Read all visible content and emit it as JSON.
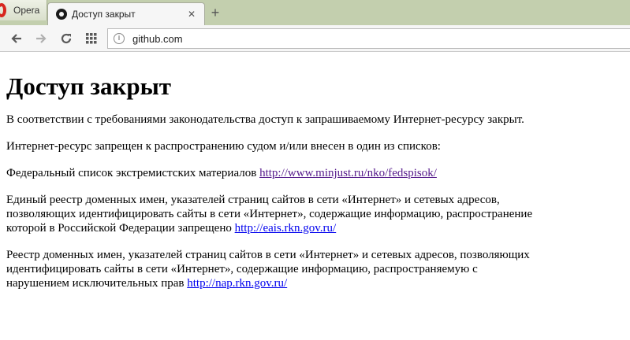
{
  "browser": {
    "menu_label": "Opera",
    "tab": {
      "title": "Доступ закрыт",
      "close_glyph": "✕"
    },
    "new_tab_glyph": "+",
    "address": "github.com",
    "info_glyph": "i"
  },
  "page": {
    "heading": "Доступ закрыт",
    "intro": "В соответствии с требованиями законодательства доступ к запрашиваемому Интернет-ресурсу закрыт.",
    "reason": "Интернет-ресурс запрещен к распространению судом и/или внесен в один из списков:",
    "list1_text": "Федеральный список экстремистских материалов",
    "list1_link": "http://www.minjust.ru/nko/fedspisok/",
    "list2_text": "Единый реестр доменных имен, указателей страниц сайтов в сети «Интернет» и сетевых адресов, позволяющих идентифицировать сайты в сети «Интернет», содержащие информацию, распространение которой в Российской Федерации запрещено",
    "list2_link": "http://eais.rkn.gov.ru/",
    "list3_text": "Реестр доменных имен, указателей страниц сайтов в сети «Интернет» и сетевых адресов, позволяющих идентифицировать сайты в сети «Интернет», содержащие информацию, распространяемую с нарушением исключительных прав",
    "list3_link": "http://nap.rkn.gov.ru/"
  },
  "colors": {
    "tabstrip": "#c3cfae",
    "link": "#0000ee",
    "visited_link": "#551a8b",
    "opera_red": "#d7261e"
  }
}
